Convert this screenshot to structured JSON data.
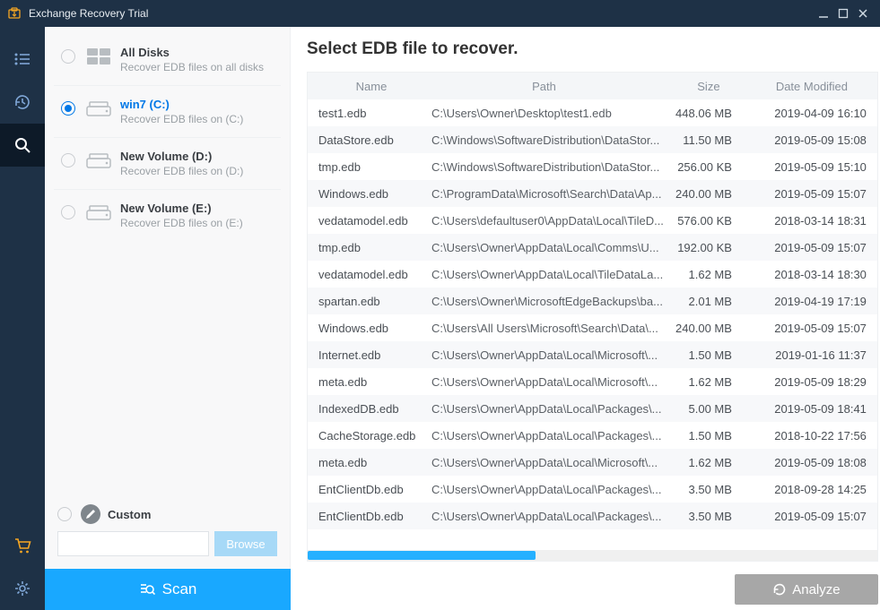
{
  "window": {
    "title": "Exchange Recovery Trial"
  },
  "rail": {
    "items": [
      {
        "name": "list-icon"
      },
      {
        "name": "history-icon"
      },
      {
        "name": "search-icon",
        "active": true
      }
    ],
    "bottom": [
      {
        "name": "cart-icon"
      },
      {
        "name": "settings-icon"
      }
    ]
  },
  "drives": [
    {
      "title": "All Disks",
      "subtitle": "Recover EDB files on all disks",
      "selected": false,
      "icon": "all-disks-icon"
    },
    {
      "title": "win7 (C:)",
      "subtitle": "Recover EDB files on (C:)",
      "selected": true,
      "icon": "drive-icon"
    },
    {
      "title": "New Volume (D:)",
      "subtitle": "Recover EDB files on (D:)",
      "selected": false,
      "icon": "drive-icon"
    },
    {
      "title": "New Volume (E:)",
      "subtitle": "Recover EDB files on (E:)",
      "selected": false,
      "icon": "drive-icon"
    }
  ],
  "custom": {
    "label": "Custom",
    "browse": "Browse",
    "value": ""
  },
  "right": {
    "title": "Select EDB file to recover.",
    "columns": {
      "name": "Name",
      "path": "Path",
      "size": "Size",
      "date": "Date Modified"
    },
    "rows": [
      {
        "name": "test1.edb",
        "path": "C:\\Users\\Owner\\Desktop\\test1.edb",
        "size": "448.06 MB",
        "date": "2019-04-09 16:10"
      },
      {
        "name": "DataStore.edb",
        "path": "C:\\Windows\\SoftwareDistribution\\DataStor...",
        "size": "11.50 MB",
        "date": "2019-05-09 15:08"
      },
      {
        "name": "tmp.edb",
        "path": "C:\\Windows\\SoftwareDistribution\\DataStor...",
        "size": "256.00 KB",
        "date": "2019-05-09 15:10"
      },
      {
        "name": "Windows.edb",
        "path": "C:\\ProgramData\\Microsoft\\Search\\Data\\Ap...",
        "size": "240.00 MB",
        "date": "2019-05-09 15:07"
      },
      {
        "name": "vedatamodel.edb",
        "path": "C:\\Users\\defaultuser0\\AppData\\Local\\TileD...",
        "size": "576.00 KB",
        "date": "2018-03-14 18:31"
      },
      {
        "name": "tmp.edb",
        "path": "C:\\Users\\Owner\\AppData\\Local\\Comms\\U...",
        "size": "192.00 KB",
        "date": "2019-05-09 15:07"
      },
      {
        "name": "vedatamodel.edb",
        "path": "C:\\Users\\Owner\\AppData\\Local\\TileDataLa...",
        "size": "1.62 MB",
        "date": "2018-03-14 18:30"
      },
      {
        "name": "spartan.edb",
        "path": "C:\\Users\\Owner\\MicrosoftEdgeBackups\\ba...",
        "size": "2.01 MB",
        "date": "2019-04-19 17:19"
      },
      {
        "name": "Windows.edb",
        "path": "C:\\Users\\All Users\\Microsoft\\Search\\Data\\...",
        "size": "240.00 MB",
        "date": "2019-05-09 15:07"
      },
      {
        "name": "Internet.edb",
        "path": "C:\\Users\\Owner\\AppData\\Local\\Microsoft\\...",
        "size": "1.50 MB",
        "date": "2019-01-16 11:37"
      },
      {
        "name": "meta.edb",
        "path": "C:\\Users\\Owner\\AppData\\Local\\Microsoft\\...",
        "size": "1.62 MB",
        "date": "2019-05-09 18:29"
      },
      {
        "name": "IndexedDB.edb",
        "path": "C:\\Users\\Owner\\AppData\\Local\\Packages\\...",
        "size": "5.00 MB",
        "date": "2019-05-09 18:41"
      },
      {
        "name": "CacheStorage.edb",
        "path": "C:\\Users\\Owner\\AppData\\Local\\Packages\\...",
        "size": "1.50 MB",
        "date": "2018-10-22 17:56"
      },
      {
        "name": "meta.edb",
        "path": "C:\\Users\\Owner\\AppData\\Local\\Microsoft\\...",
        "size": "1.62 MB",
        "date": "2019-05-09 18:08"
      },
      {
        "name": "EntClientDb.edb",
        "path": "C:\\Users\\Owner\\AppData\\Local\\Packages\\...",
        "size": "3.50 MB",
        "date": "2018-09-28 14:25"
      },
      {
        "name": "EntClientDb.edb",
        "path": "C:\\Users\\Owner\\AppData\\Local\\Packages\\...",
        "size": "3.50 MB",
        "date": "2019-05-09 15:07"
      }
    ]
  },
  "footer": {
    "scan": "Scan",
    "analyze": "Analyze"
  }
}
